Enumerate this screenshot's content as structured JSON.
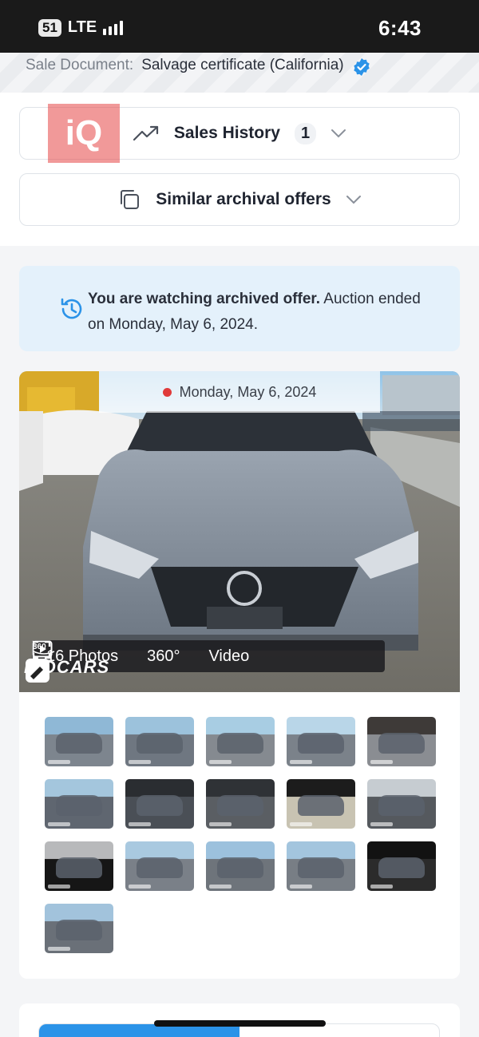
{
  "status_bar": {
    "badge": "51",
    "network": "LTE",
    "time": "6:43"
  },
  "sale_document": {
    "label": "Sale Document:",
    "value": "Salvage certificate (California)"
  },
  "watermark": {
    "text": "iQ"
  },
  "sales_history": {
    "label": "Sales History",
    "count": "1"
  },
  "similar_offers": {
    "label": "Similar archival offers"
  },
  "notice": {
    "bold": "You are watching archived offer.",
    "text": " Auction ended on Monday, May 6, 2024."
  },
  "gallery": {
    "date": "Monday, May 6, 2024",
    "photos_label": "16 Photos",
    "view360_label": "360°",
    "view360_icon_text": "360",
    "video_label": "Video",
    "brand": "BIDCARS",
    "thumbnail_count": 16
  },
  "colors": {
    "accent": "#2b93e8",
    "notice_bg": "#e4f1fb",
    "live_dot": "#e03a3a"
  },
  "progress": {
    "fraction": 0.5
  }
}
